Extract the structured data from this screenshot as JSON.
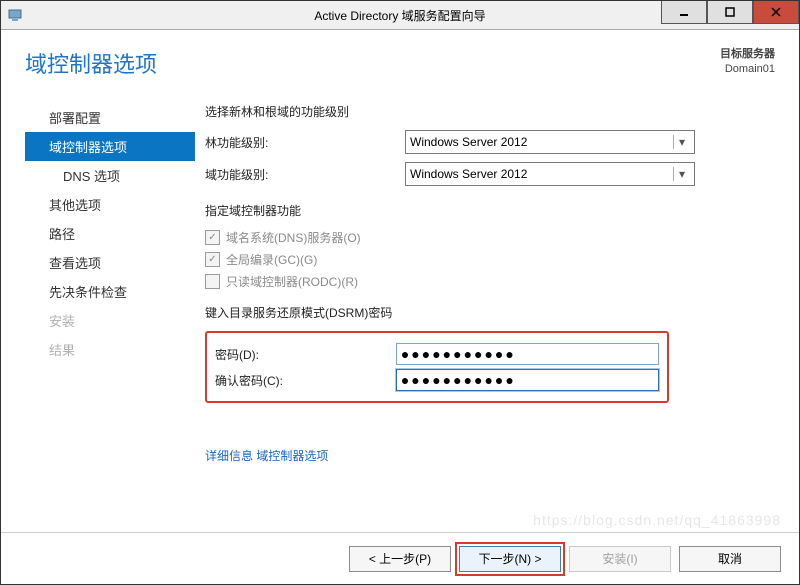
{
  "titlebar": {
    "title": "Active Directory 域服务配置向导"
  },
  "header": {
    "page_title": "域控制器选项",
    "target_label": "目标服务器",
    "target_value": "Domain01"
  },
  "nav": {
    "items": [
      {
        "label": "部署配置"
      },
      {
        "label": "域控制器选项"
      },
      {
        "label": "DNS 选项"
      },
      {
        "label": "其他选项"
      },
      {
        "label": "路径"
      },
      {
        "label": "查看选项"
      },
      {
        "label": "先决条件检查"
      },
      {
        "label": "安装"
      },
      {
        "label": "结果"
      }
    ]
  },
  "main": {
    "func_level_heading": "选择新林和根域的功能级别",
    "forest_label": "林功能级别:",
    "forest_value": "Windows Server 2012",
    "domain_label": "域功能级别:",
    "domain_value": "Windows Server 2012",
    "capabilities_heading": "指定域控制器功能",
    "chk_dns": "域名系统(DNS)服务器(O)",
    "chk_gc": "全局编录(GC)(G)",
    "chk_rodc": "只读域控制器(RODC)(R)",
    "dsrm_heading": "键入目录服务还原模式(DSRM)密码",
    "pwd_label": "密码(D):",
    "pwd_value": "●●●●●●●●●●●",
    "confirm_label": "确认密码(C):",
    "confirm_value": "●●●●●●●●●●●",
    "more_link": "详细信息 域控制器选项"
  },
  "buttons": {
    "prev": "< 上一步(P)",
    "next": "下一步(N) >",
    "install": "安装(I)",
    "cancel": "取消"
  },
  "watermark": "https://blog.csdn.net/qq_41863998"
}
